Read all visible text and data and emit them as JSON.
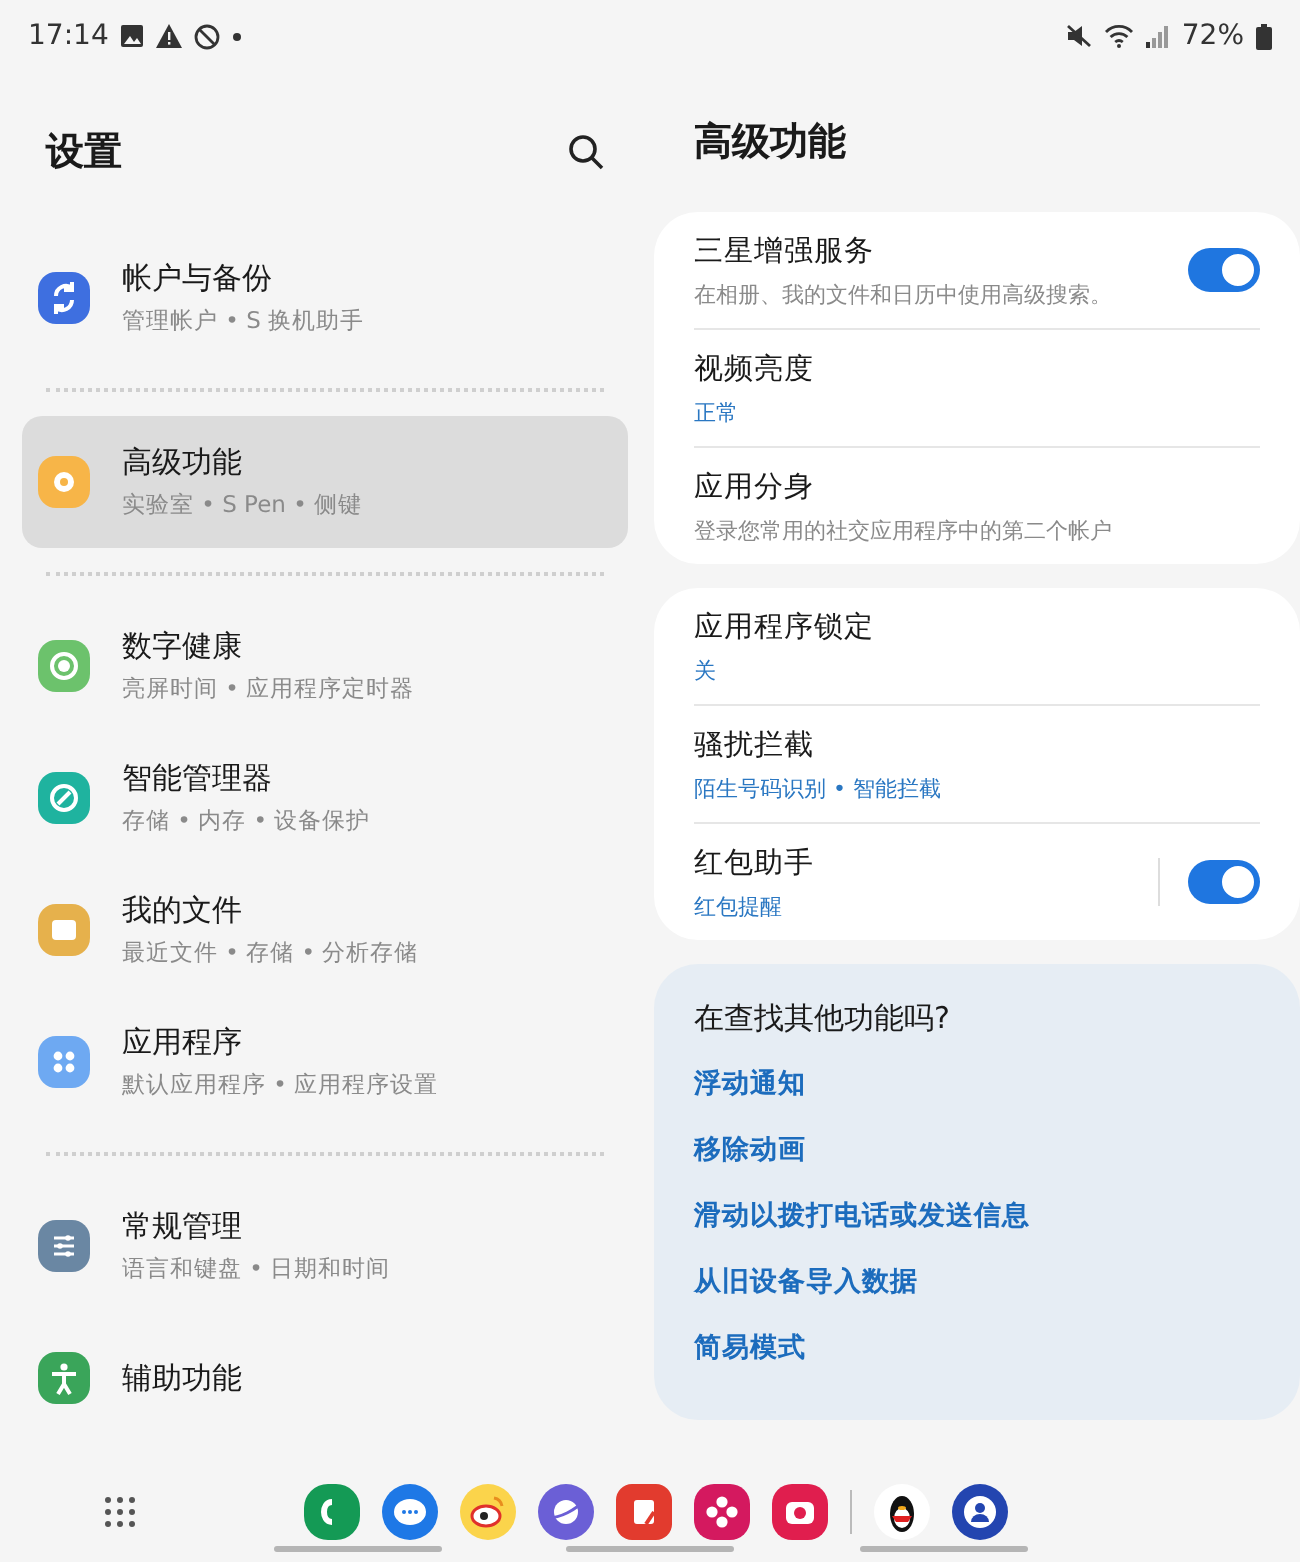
{
  "status_bar": {
    "time": "17:14",
    "battery": "72%"
  },
  "sidebar": {
    "title": "设置",
    "groups": [
      [
        {
          "title": "帐户与备份",
          "subtitle": "管理帐户 • S 换机助手",
          "color": "#3e6fe0",
          "selected": false
        }
      ],
      [
        {
          "title": "高级功能",
          "subtitle": "实验室 • S Pen • 侧键",
          "color": "#f7b548",
          "selected": true
        }
      ],
      [
        {
          "title": "数字健康",
          "subtitle": "亮屏时间 • 应用程序定时器",
          "color": "#6cc26c",
          "selected": false
        },
        {
          "title": "智能管理器",
          "subtitle": "存储 • 内存 • 设备保护",
          "color": "#1fb39f",
          "selected": false
        },
        {
          "title": "我的文件",
          "subtitle": "最近文件 • 存储 • 分析存储",
          "color": "#e6b14c",
          "selected": false
        },
        {
          "title": "应用程序",
          "subtitle": "默认应用程序 • 应用程序设置",
          "color": "#6ea9f2",
          "selected": false
        }
      ],
      [
        {
          "title": "常规管理",
          "subtitle": "语言和键盘 • 日期和时间",
          "color": "#6a87a3",
          "selected": false
        },
        {
          "title": "辅助功能",
          "color": "#3aa55a",
          "selected": false
        }
      ]
    ]
  },
  "detail": {
    "title": "高级功能",
    "cards": [
      [
        {
          "title": "三星增强服务",
          "subtitle": "在相册、我的文件和日历中使用高级搜索。",
          "accent": false,
          "switch": {
            "on": true,
            "divider": false
          }
        },
        {
          "title": "视频亮度",
          "subtitle": "正常",
          "accent": true
        },
        {
          "title": "应用分身",
          "subtitle": "登录您常用的社交应用程序中的第二个帐户",
          "accent": false
        }
      ],
      [
        {
          "title": "应用程序锁定",
          "subtitle": "关",
          "accent": true
        },
        {
          "title": "骚扰拦截",
          "subtitle": "陌生号码识别 • 智能拦截",
          "accent": true
        },
        {
          "title": "红包助手",
          "subtitle": "红包提醒",
          "accent": true,
          "switch": {
            "on": true,
            "divider": true
          }
        }
      ]
    ],
    "suggestions": {
      "title": "在查找其他功能吗?",
      "links": [
        "浮动通知",
        "移除动画",
        "滑动以拨打电话或发送信息",
        "从旧设备导入数据",
        "简易模式"
      ]
    }
  }
}
